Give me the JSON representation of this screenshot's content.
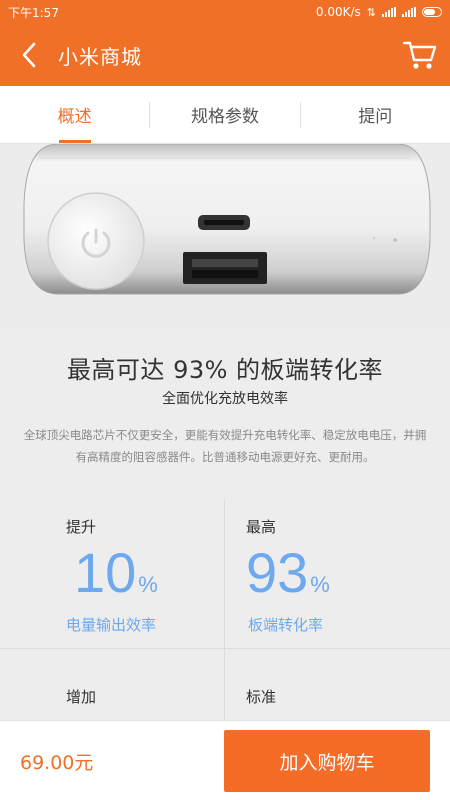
{
  "status_bar": {
    "time": "下午1:57",
    "network_speed": "0.00K/s"
  },
  "header": {
    "title": "小米商城",
    "back_icon": "chevron-left-icon",
    "cart_icon": "cart-icon"
  },
  "tabs": [
    {
      "label": "概述",
      "active": true
    },
    {
      "label": "规格参数",
      "active": false
    },
    {
      "label": "提问",
      "active": false
    }
  ],
  "content": {
    "heading": "最高可达 93% 的板端转化率",
    "subheading": "全面优化充放电效率",
    "description": "全球顶尖电路芯片不仅更安全，更能有效提升充电转化率、稳定放电电压，并拥有高精度的阻容感器件。比普通移动电源更好充、更耐用。"
  },
  "stats": [
    {
      "label": "提升",
      "value": "10",
      "unit": "%",
      "caption": "电量输出效率"
    },
    {
      "label": "最高",
      "value": "93",
      "unit": "%",
      "caption": "板端转化率"
    },
    {
      "label": "增加"
    },
    {
      "label": "标准"
    }
  ],
  "bottom_bar": {
    "price": "69.00元",
    "add_to_cart_label": "加入购物车"
  },
  "colors": {
    "accent": "#f07028",
    "stat_blue": "#6ea8ee"
  }
}
